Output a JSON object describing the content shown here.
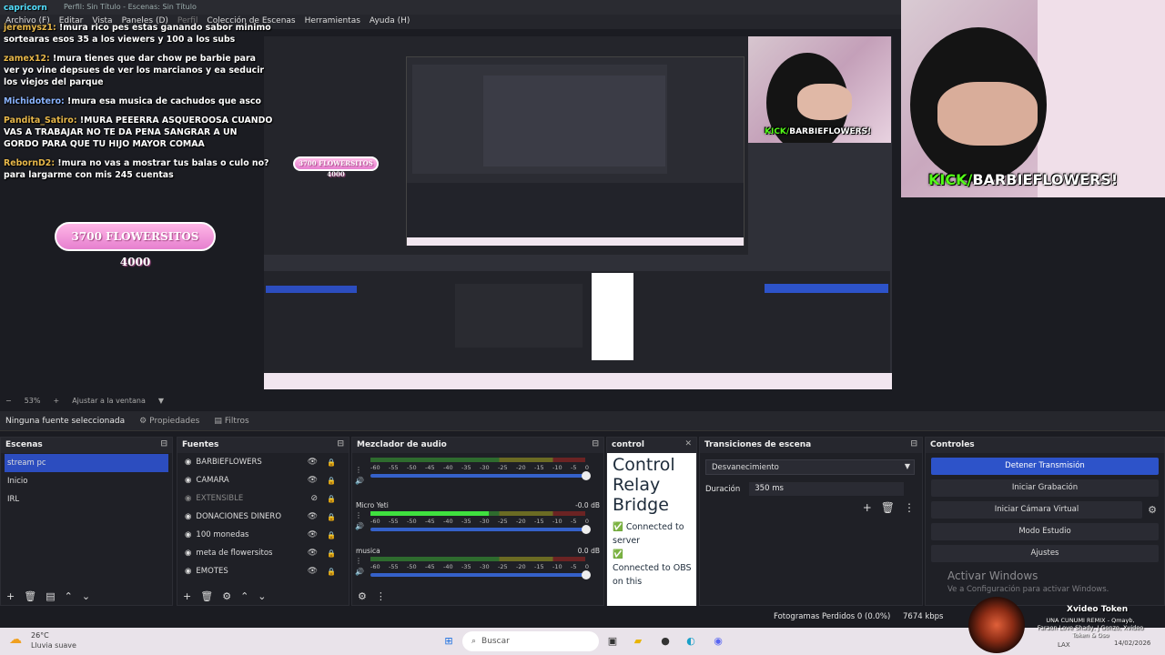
{
  "window": {
    "title": "Perfil: Sin Título - Escenas: Sin Título",
    "chat_top_name": "capricorn"
  },
  "menu": [
    "Archivo (F)",
    "Editar",
    "Vista",
    "Paneles (D)",
    "Perfil",
    "Colección de Escenas",
    "Herramientas",
    "Ayuda (H)"
  ],
  "chat": [
    {
      "user": "jeremysz1:",
      "text": " !mura rico pes estas ganando sabor minimo sortearas esos 35 a los viewers y 100 a los subs"
    },
    {
      "user": "zamex12:",
      "text": " !mura tienes que dar chow pe barbie para ver yo vine depsues de ver los marcianos y ea seducir los viejos del parque"
    },
    {
      "user": "Michidotero:",
      "text": " !mura esa musica de cachudos que asco"
    },
    {
      "user": "Pandita_Satiro:",
      "text": " !MURA PEEERRA ASQUEROOSA CUANDO VAS A TRABAJAR NO TE DA PENA SANGRAR A UN GORDO PARA QUE TU HIJO MAYOR COMAA"
    },
    {
      "user": "RebornD2:",
      "text": " !mura no vas a mostrar tus balas o culo no? para largarme con mis 245 cuentas"
    }
  ],
  "goal": {
    "text": "3700 FLOWERSITOS 4000"
  },
  "webcam": {
    "kick_prefix": "KICK/",
    "channel": "BARBIEFLOWERS!"
  },
  "zoom": {
    "percent": "53%",
    "fit_label": "Ajustar a la ventana"
  },
  "propbar": {
    "no_source": "Ninguna fuente seleccionada",
    "properties": "Propiedades",
    "filters": "Filtros"
  },
  "scenes": {
    "title": "Escenas",
    "items": [
      "stream pc",
      "Inicio",
      "IRL"
    ],
    "selected": 0
  },
  "sources": {
    "title": "Fuentes",
    "items": [
      "BARBIEFLOWERS",
      "CAMARA",
      "EXTENSIBLE",
      "DONACIONES DINERO",
      "100 monedas",
      "meta de flowersitos",
      "EMOTES"
    ],
    "disabled_index": 2
  },
  "mixer": {
    "title": "Mezclador de audio",
    "ticks": [
      "-60",
      "-55",
      "-50",
      "-45",
      "-40",
      "-35",
      "-30",
      "-25",
      "-20",
      "-15",
      "-10",
      "-5",
      "0"
    ],
    "channels": [
      {
        "name": "",
        "db": "",
        "level": 0.0
      },
      {
        "name": "Micro Yeti",
        "db": "-0.0 dB",
        "level": 0.55
      },
      {
        "name": "musica",
        "db": "0.0 dB",
        "level": 0.0
      }
    ]
  },
  "control": {
    "title": "control",
    "heading_lines": [
      "Control",
      "Relay",
      "Bridge"
    ],
    "status_lines": [
      "✅ Connected to server",
      "✅",
      "Connected to OBS on this"
    ]
  },
  "transitions": {
    "title": "Transiciones de escena",
    "selected": "Desvanecimiento",
    "duration_label": "Duración",
    "duration_value": "350 ms"
  },
  "controls": {
    "title": "Controles",
    "buttons": [
      "Detener Transmisión",
      "Iniciar Grabación",
      "Iniciar Cámara Virtual",
      "Modo Estudio",
      "Ajustes"
    ]
  },
  "activate": {
    "title": "Activar Windows",
    "subtitle": "Ve a Configuración para activar Windows."
  },
  "status": {
    "frames": "Fotogramas Perdidos 0 (0.0%)",
    "kbps": "7674 kbps"
  },
  "music": {
    "title": "Xvideo Token",
    "artists": "UNA CUNUMI REMIX - Qmayb, Faraon Love Shady, J Gonzo, Xvideo Token & Oso"
  },
  "taskbar": {
    "temp": "26°C",
    "weather": "Lluvia suave",
    "search": "Buscar",
    "lang": "LAX",
    "date": "14/02/2026"
  },
  "colors": {
    "accent": "#2d53c9",
    "pink": "#e680cf",
    "kick_green": "#53fc18"
  }
}
